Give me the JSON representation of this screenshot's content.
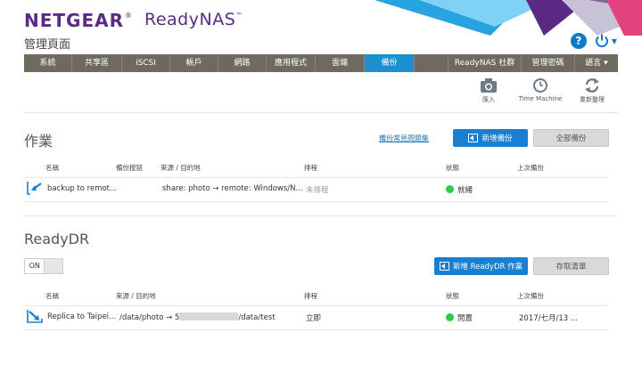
{
  "header": {
    "brand": "NETGEAR",
    "brand_reg": "®",
    "product": "ReadyNAS",
    "product_tm": "™",
    "page_title": "管理頁面"
  },
  "nav": {
    "items": [
      {
        "label": "系統"
      },
      {
        "label": "共享區"
      },
      {
        "label": "iSCSI"
      },
      {
        "label": "帳戶"
      },
      {
        "label": "網路"
      },
      {
        "label": "應用程式"
      },
      {
        "label": "雲端"
      },
      {
        "label": "備份",
        "active": true
      },
      {
        "label": ""
      },
      {
        "label": "ReadyNAS 社群"
      },
      {
        "label": "管理密碼"
      },
      {
        "label": "語言 ▾"
      }
    ]
  },
  "toolbar": {
    "import_label": "匯入",
    "timemachine_label": "Time Machine",
    "refresh_label": "重新整理"
  },
  "jobs": {
    "title": "作業",
    "faq_link": "備份常見問題集",
    "add_button": "新增備份",
    "all_button": "全部備份",
    "columns": {
      "name": "名稱",
      "button": "備份按鈕",
      "source_dest": "來源 / 目的地",
      "schedule": "排程",
      "status": "狀態",
      "last": "上次備份"
    },
    "rows": [
      {
        "name": "backup to remot...",
        "source_dest": "share: photo → remote: Windows/N...",
        "schedule": "未排程",
        "status": "就緒",
        "last": ""
      }
    ]
  },
  "readydr": {
    "title": "ReadyDR",
    "toggle_label": "ON",
    "add_button": "新增 ReadyDR 作業",
    "clear_button": "存取清單",
    "columns": {
      "name": "名稱",
      "source_dest": "來源 / 目的地",
      "schedule": "排程",
      "status": "狀態",
      "last": "上次備份"
    },
    "rows": [
      {
        "name": "Replica to Taipei...",
        "source_prefix": "/data/photo → 5",
        "source_suffix": "/data/test",
        "schedule": "立即",
        "status": "閒置",
        "last": "2017/七月/13 ..."
      }
    ]
  },
  "colors": {
    "brand_purple": "#5a2a82",
    "nav_bg": "#6e6a60",
    "nav_active": "#1b8fd0",
    "primary_button": "#1a7fd0",
    "status_green": "#2ecc40",
    "help_blue": "#0f7ac7"
  },
  "icons": [
    "help-icon",
    "power-icon",
    "camera-icon",
    "clock-icon",
    "refresh-icon",
    "backup-job-icon",
    "replica-job-icon",
    "add-job-icon"
  ]
}
